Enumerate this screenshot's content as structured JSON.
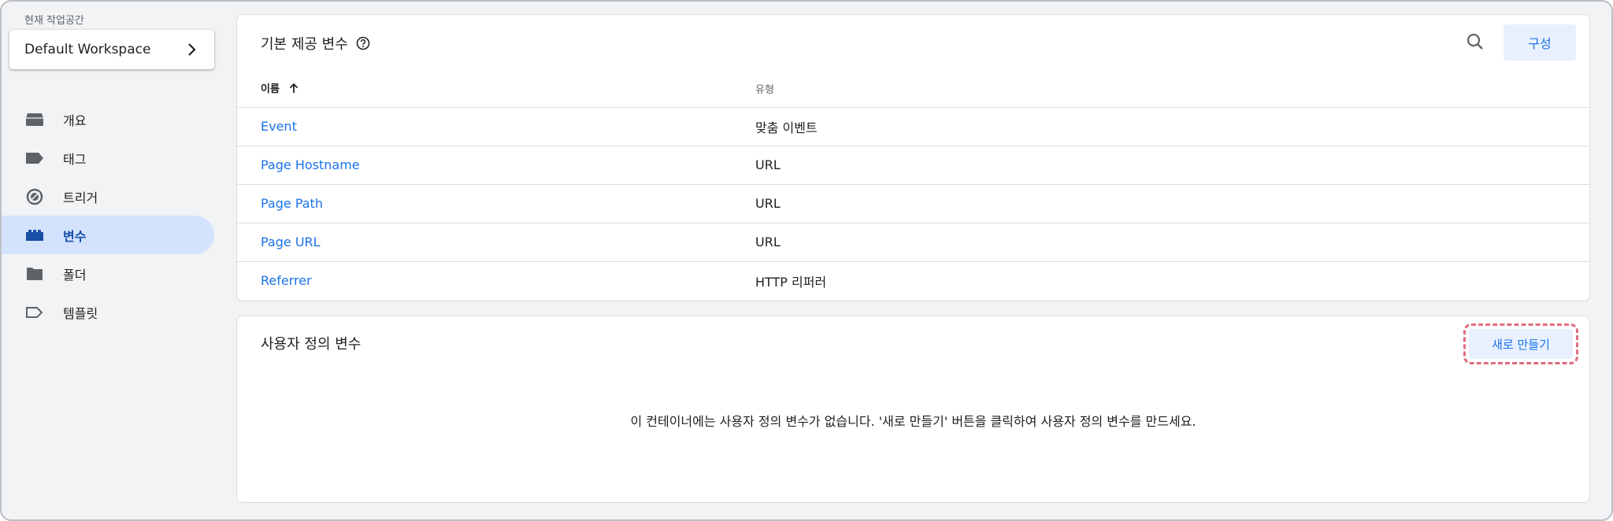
{
  "workspace": {
    "caption": "현재 작업공간",
    "name": "Default Workspace"
  },
  "nav": {
    "items": [
      {
        "label": "개요",
        "icon": "overview-icon"
      },
      {
        "label": "태그",
        "icon": "tag-icon"
      },
      {
        "label": "트리거",
        "icon": "trigger-icon"
      },
      {
        "label": "변수",
        "icon": "variables-icon",
        "active": true
      },
      {
        "label": "폴더",
        "icon": "folder-icon"
      },
      {
        "label": "템플릿",
        "icon": "template-icon"
      }
    ]
  },
  "builtin": {
    "title": "기본 제공 변수",
    "configure_label": "구성",
    "columns": {
      "name": "이름",
      "type": "유형"
    },
    "rows": [
      {
        "name": "Event",
        "type": "맞춤 이벤트"
      },
      {
        "name": "Page Hostname",
        "type": "URL"
      },
      {
        "name": "Page Path",
        "type": "URL"
      },
      {
        "name": "Page URL",
        "type": "URL"
      },
      {
        "name": "Referrer",
        "type": "HTTP 리퍼러"
      }
    ]
  },
  "custom": {
    "title": "사용자 정의 변수",
    "new_label": "새로 만들기",
    "empty_message": "이 컨테이너에는 사용자 정의 변수가 없습니다. '새로 만들기' 버튼을 클릭하여 사용자 정의 변수를 만드세요."
  },
  "colors": {
    "accent": "#1a73e8",
    "active_nav_bg": "#d3e3fd",
    "button_bg": "#e8f0fe",
    "highlight_border": "#e06c81",
    "page_bg": "#f1f3f4"
  }
}
